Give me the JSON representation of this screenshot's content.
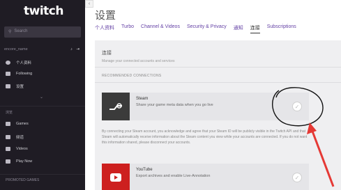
{
  "sidebar": {
    "logo": "twitch",
    "search_placeholder": "Search",
    "username": "encore_name",
    "user_controls": "♪ ⇥",
    "nav_top": [
      "个人资料",
      "Following",
      "设置"
    ],
    "browse_label": "浏览",
    "nav_browse": [
      "Games",
      "频道",
      "Videos",
      "Play Now"
    ],
    "promoted_label": "PROMOTED GAMES"
  },
  "collapse_tab": "‹",
  "page": {
    "title": "设置",
    "tabs": [
      "个人资料",
      "Turbo",
      "Channel & Videos",
      "Security & Privacy",
      "通知",
      "连接",
      "Subscriptions"
    ],
    "active_tab_index": 5
  },
  "connections": {
    "title": "连接",
    "subtitle": "Manage your connected accounts and services",
    "recommended_label": "RECOMMENDED CONNECTIONS",
    "items": [
      {
        "name": "Steam",
        "description": "Share your game meta data when you go live",
        "brand_color": "#3b3b3b",
        "icon": "steam-icon"
      },
      {
        "name": "YouTube",
        "description": "Export archives and enable Live-Annotation",
        "brand_color": "#cd201f",
        "icon": "youtube-play-icon"
      }
    ],
    "steam_disclaimer": "By connecting your Steam account, you acknowledge and agree that your Steam ID will be publicly visible in the Twitch API and that Steam will automatically receive information about the Steam content you view while your accounts are connected. If you do not want this information shared, please disconnect your accounts."
  },
  "colors": {
    "sidebar_bg": "#1f1c24",
    "accent": "#6441a5",
    "annotation": "#e53935"
  }
}
